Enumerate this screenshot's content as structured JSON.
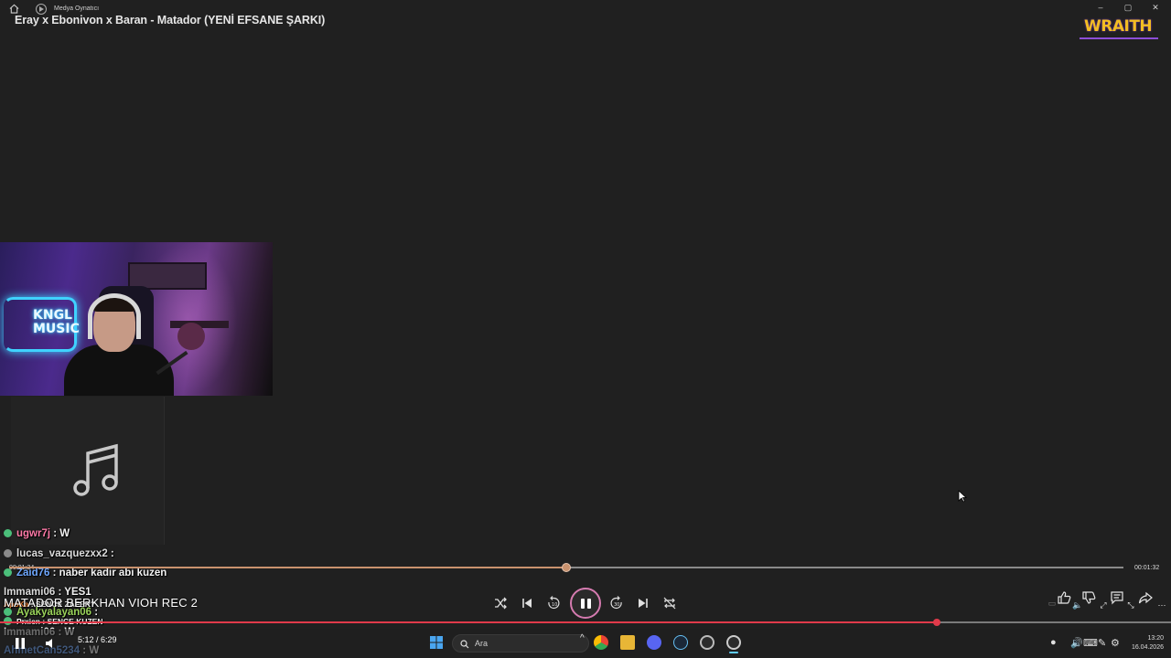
{
  "window": {
    "app_name": "Medya Oynatıcı",
    "minimize": "–",
    "maximize": "▢",
    "close": "✕"
  },
  "video_title": "Eray x Ebonivon x Baran - Matador (YENİ EFSANE ŞARKI)",
  "channel_logo": "WRAITH",
  "webcam_overlay_text": [
    "KNGL",
    "MUSIC"
  ],
  "chat": [
    {
      "user": "ugwr7j",
      "message": "W",
      "user_color": "#ff7aa8",
      "badge_color": "#4bbf7a"
    },
    {
      "user": "lucas_vazquezxx2",
      "message": "",
      "user_color": "#dcdcdc",
      "badge_color": "#8a8a8a"
    },
    {
      "user": "Zaid76",
      "message": "naber kadir abi kuzen",
      "user_color": "#6fa8ff",
      "badge_color": "#4bbf7a"
    },
    {
      "user": "Immami06",
      "message": "YES1",
      "user_color": "#dcdcdc",
      "badge_color": ""
    },
    {
      "user": "ApoKa",
      "message": "SENCE ZAFER?",
      "user_color": "#ff8a3a",
      "badge_color": ""
    },
    {
      "user": "Ayakyalayan06",
      "message": "",
      "user_color": "#9ad35a",
      "badge_color": "#4bbf7a"
    },
    {
      "user": "Prxien",
      "message": "SENCE KUZEN",
      "user_color": "#ffffff",
      "badge_color": "#4bbf7a"
    },
    {
      "user": "Immami06",
      "message": "W",
      "user_color": "#dcdcdc",
      "badge_color": ""
    },
    {
      "user": "AhmetCan5234",
      "message": "W",
      "user_color": "#6fa8ff",
      "badge_color": ""
    }
  ],
  "player": {
    "elapsed": "00:01:24",
    "remaining": "00:01:32",
    "progress": 0.5,
    "now_playing": "MATADOR BERKHAN VIOH REC 2"
  },
  "stream_player": {
    "time": "5:12 / 6:29",
    "progress": 0.8
  },
  "taskbar": {
    "search_placeholder": "Ara",
    "clock_time": "13:20",
    "clock_date": "16.04.2026"
  },
  "colors": {
    "accent_seek": "#c9926e",
    "accent_play_ring": "#d57bb0",
    "stream_progress": "#e03a4a",
    "logo": "#f2bd22"
  }
}
